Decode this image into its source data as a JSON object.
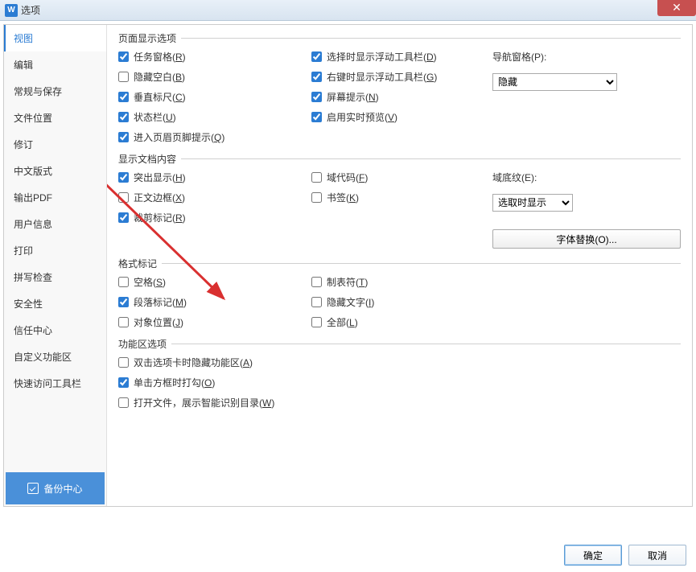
{
  "title": "选项",
  "app_icon_letter": "W",
  "sidebar": {
    "items": [
      {
        "label": "视图",
        "active": true
      },
      {
        "label": "编辑"
      },
      {
        "label": "常规与保存"
      },
      {
        "label": "文件位置"
      },
      {
        "label": "修订"
      },
      {
        "label": "中文版式"
      },
      {
        "label": "输出PDF"
      },
      {
        "label": "用户信息"
      },
      {
        "label": "打印"
      },
      {
        "label": "拼写检查"
      },
      {
        "label": "安全性"
      },
      {
        "label": "信任中心"
      },
      {
        "label": "自定义功能区"
      },
      {
        "label": "快速访问工具栏"
      }
    ],
    "backup_label": "备份中心"
  },
  "groups": {
    "page_display": {
      "legend": "页面显示选项",
      "col1": [
        {
          "label": "任务窗格(R)",
          "checked": true
        },
        {
          "label": "隐藏空白(B)",
          "checked": false
        },
        {
          "label": "垂直标尺(C)",
          "checked": true
        },
        {
          "label": "状态栏(U)",
          "checked": true
        },
        {
          "label": "进入页眉页脚提示(Q)",
          "checked": true
        }
      ],
      "col2": [
        {
          "label": "选择时显示浮动工具栏(D)",
          "checked": true
        },
        {
          "label": "右键时显示浮动工具栏(G)",
          "checked": true
        },
        {
          "label": "屏幕提示(N)",
          "checked": true
        },
        {
          "label": "启用实时预览(V)",
          "checked": true
        }
      ],
      "nav_label": "导航窗格(P):",
      "nav_value": "隐藏"
    },
    "doc_content": {
      "legend": "显示文档内容",
      "col1": [
        {
          "label": "突出显示(H)",
          "checked": true
        },
        {
          "label": "正文边框(X)",
          "checked": false
        },
        {
          "label": "裁剪标记(R)",
          "checked": true
        }
      ],
      "col2": [
        {
          "label": "域代码(F)",
          "checked": false
        },
        {
          "label": "书签(K)",
          "checked": false
        }
      ],
      "shading_label": "域底纹(E):",
      "shading_value": "选取时显示",
      "font_btn": "字体替换(O)..."
    },
    "format_marks": {
      "legend": "格式标记",
      "col1": [
        {
          "label": "空格(S)",
          "checked": false
        },
        {
          "label": "段落标记(M)",
          "checked": true
        },
        {
          "label": "对象位置(J)",
          "checked": false
        }
      ],
      "col2": [
        {
          "label": "制表符(T)",
          "checked": false
        },
        {
          "label": "隐藏文字(I)",
          "checked": false
        },
        {
          "label": "全部(L)",
          "checked": false
        }
      ]
    },
    "ribbon": {
      "legend": "功能区选项",
      "items": [
        {
          "label": "双击选项卡时隐藏功能区(A)",
          "checked": false
        },
        {
          "label": "单击方框时打勾(O)",
          "checked": true
        },
        {
          "label": "打开文件，展示智能识别目录(W)",
          "checked": false
        }
      ]
    }
  },
  "footer": {
    "ok": "确定",
    "cancel": "取消"
  }
}
